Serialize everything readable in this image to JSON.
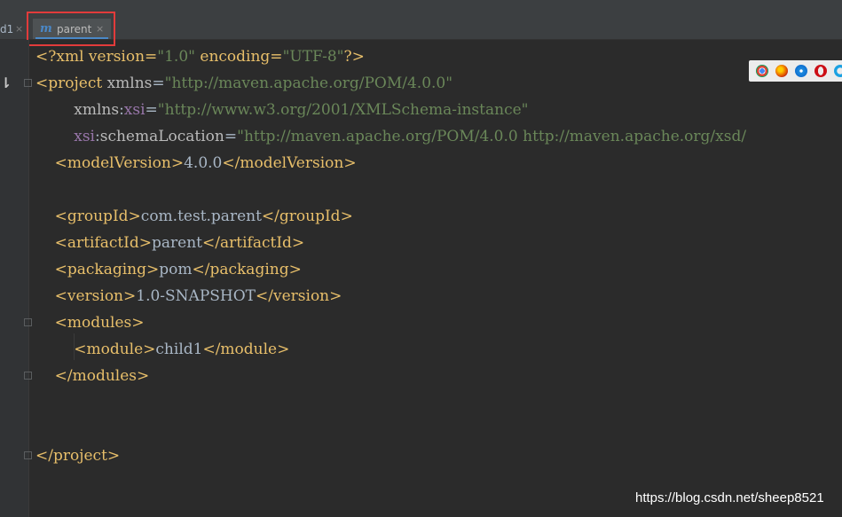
{
  "tabs": [
    {
      "label": "d1",
      "close": "×"
    },
    {
      "icon": "m",
      "label": "parent",
      "close": "×",
      "active": true
    }
  ],
  "code_lines": [
    [
      {
        "t": "pi",
        "v": "<?xml version="
      },
      {
        "t": "str",
        "v": "\"1.0\""
      },
      {
        "t": "pi",
        "v": " encoding="
      },
      {
        "t": "str",
        "v": "\"UTF-8\""
      },
      {
        "t": "pi",
        "v": "?>"
      }
    ],
    [
      {
        "t": "tag",
        "v": "<project "
      },
      {
        "t": "attr",
        "v": "xmlns"
      },
      {
        "t": "txt",
        "v": "="
      },
      {
        "t": "str",
        "v": "\"http://maven.apache.org/POM/4.0.0\""
      }
    ],
    [
      {
        "t": "txt",
        "v": "        "
      },
      {
        "t": "attr",
        "v": "xmlns"
      },
      {
        "t": "txt",
        "v": ":"
      },
      {
        "t": "ns",
        "v": "xsi"
      },
      {
        "t": "txt",
        "v": "="
      },
      {
        "t": "str",
        "v": "\"http://www.w3.org/2001/XMLSchema-instance\""
      }
    ],
    [
      {
        "t": "txt",
        "v": "        "
      },
      {
        "t": "ns",
        "v": "xsi"
      },
      {
        "t": "txt",
        "v": ":"
      },
      {
        "t": "attr",
        "v": "schemaLocation"
      },
      {
        "t": "txt",
        "v": "="
      },
      {
        "t": "str",
        "v": "\"http://maven.apache.org/POM/4.0.0 http://maven.apache.org/xsd/"
      }
    ],
    [
      {
        "t": "txt",
        "v": "    "
      },
      {
        "t": "tag",
        "v": "<modelVersion>"
      },
      {
        "t": "txt",
        "v": "4.0.0"
      },
      {
        "t": "tag",
        "v": "</modelVersion>"
      }
    ],
    [],
    [
      {
        "t": "txt",
        "v": "    "
      },
      {
        "t": "tag",
        "v": "<groupId>"
      },
      {
        "t": "txt",
        "v": "com.test.parent"
      },
      {
        "t": "tag",
        "v": "</groupId>"
      }
    ],
    [
      {
        "t": "txt",
        "v": "    "
      },
      {
        "t": "tag",
        "v": "<artifactId>"
      },
      {
        "t": "txt",
        "v": "parent"
      },
      {
        "t": "tag",
        "v": "</artifactId>"
      }
    ],
    [
      {
        "t": "txt",
        "v": "    "
      },
      {
        "t": "tag",
        "v": "<packaging>"
      },
      {
        "t": "txt",
        "v": "pom"
      },
      {
        "t": "tag",
        "v": "</packaging>"
      }
    ],
    [
      {
        "t": "txt",
        "v": "    "
      },
      {
        "t": "tag",
        "v": "<version>"
      },
      {
        "t": "txt",
        "v": "1.0-SNAPSHOT"
      },
      {
        "t": "tag",
        "v": "</version>"
      }
    ],
    [
      {
        "t": "txt",
        "v": "    "
      },
      {
        "t": "tag",
        "v": "<modules>"
      }
    ],
    [
      {
        "t": "txt",
        "v": "        "
      },
      {
        "t": "tag",
        "v": "<module>"
      },
      {
        "t": "txt",
        "v": "child1"
      },
      {
        "t": "tag",
        "v": "</module>"
      }
    ],
    [
      {
        "t": "txt",
        "v": "    "
      },
      {
        "t": "tag",
        "v": "</modules>"
      }
    ],
    [],
    [],
    [
      {
        "t": "tag",
        "v": "</project>"
      }
    ]
  ],
  "browser_icons": [
    "chrome-icon",
    "firefox-icon",
    "safari-icon",
    "opera-icon",
    "ie-icon"
  ],
  "colors": {
    "editor_bg": "#2b2b2b",
    "tag": "#e8bf6a",
    "string": "#6a8759",
    "namespace": "#9876aa",
    "text": "#a9b7c6",
    "highlight_box": "#e23b3b",
    "tab_underline": "#4a88c7"
  },
  "watermark": "https://blog.csdn.net/sheep8521"
}
